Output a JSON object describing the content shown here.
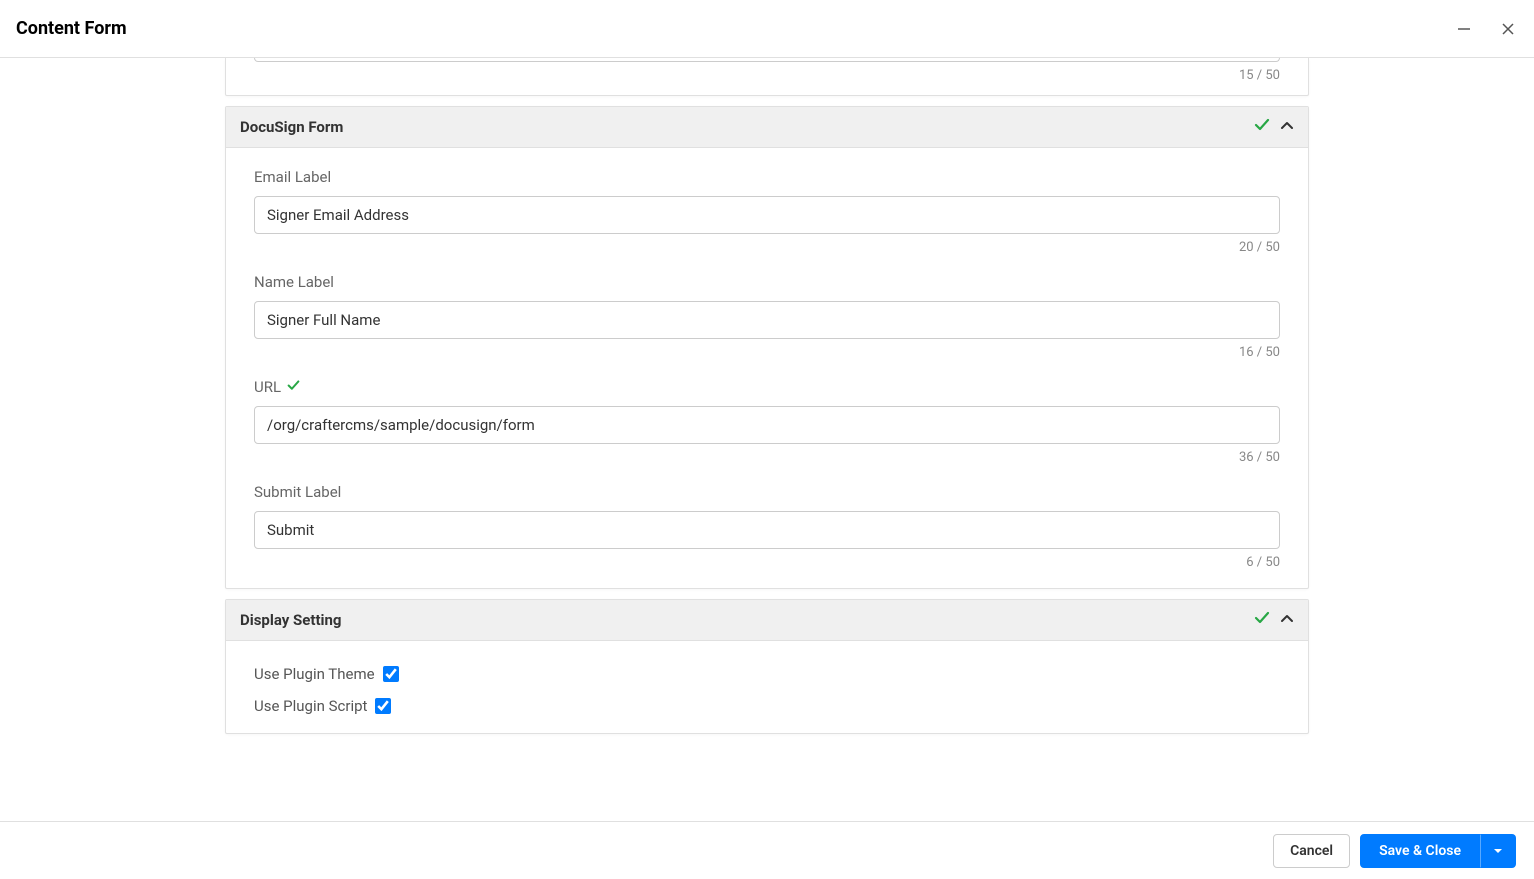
{
  "window": {
    "title": "Content Form"
  },
  "partial": {
    "counter": "15 / 50"
  },
  "sections": [
    {
      "title": "DocuSign Form",
      "valid": true,
      "fields": [
        {
          "key": "email_label",
          "label": "Email Label",
          "value": "Signer Email Address",
          "counter": "20 / 50",
          "valid": false
        },
        {
          "key": "name_label",
          "label": "Name Label",
          "value": "Signer Full Name",
          "counter": "16 / 50",
          "valid": false
        },
        {
          "key": "url",
          "label": "URL",
          "value": "/org/craftercms/sample/docusign/form",
          "counter": "36 / 50",
          "valid": true
        },
        {
          "key": "submit_label",
          "label": "Submit Label",
          "value": "Submit",
          "counter": "6 / 50",
          "valid": false
        }
      ]
    },
    {
      "title": "Display Setting",
      "valid": true,
      "checks": [
        {
          "key": "use_plugin_theme",
          "label": "Use Plugin Theme",
          "checked": true
        },
        {
          "key": "use_plugin_script",
          "label": "Use Plugin Script",
          "checked": true
        }
      ]
    }
  ],
  "footer": {
    "cancel": "Cancel",
    "save": "Save & Close"
  }
}
